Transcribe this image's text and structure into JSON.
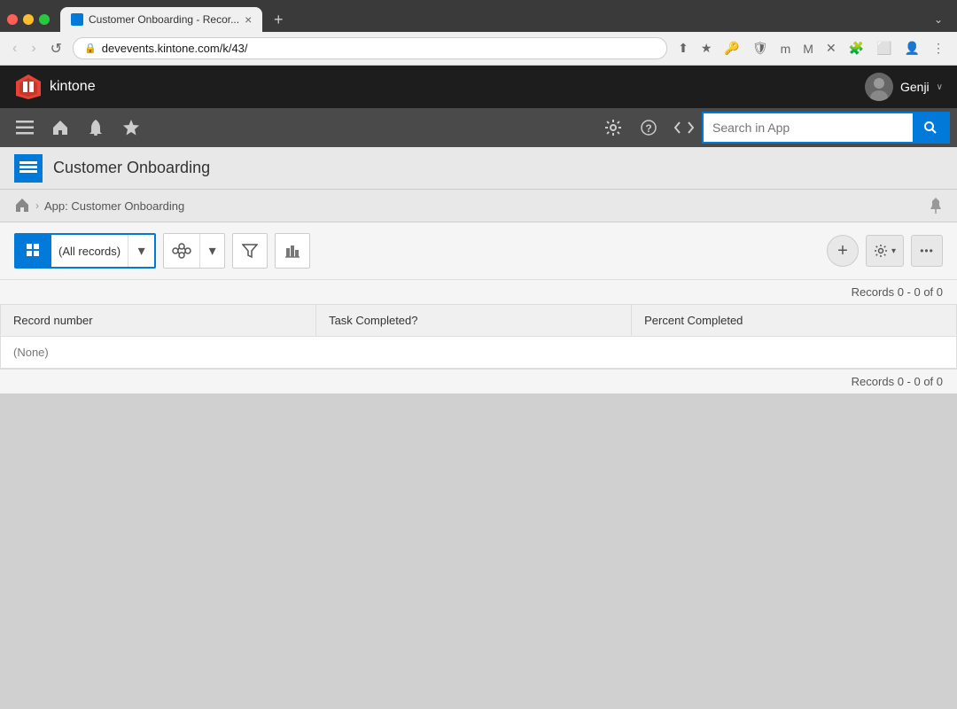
{
  "browser": {
    "tab_title": "Customer Onboarding - Recor...",
    "tab_close": "×",
    "tab_new": "+",
    "address": "devevents.kintone.com/k/43/",
    "nav_back": "‹",
    "nav_forward": "›",
    "nav_refresh": "↺",
    "extension_chevron": "»"
  },
  "header": {
    "logo_text": "kintone",
    "user_name": "Genji",
    "user_chevron": "∨"
  },
  "nav": {
    "menu_icon": "≡",
    "home_icon": "⌂",
    "bell_icon": "🔔",
    "star_icon": "★",
    "gear_icon": "⚙",
    "help_icon": "?",
    "dev_icon": "</>",
    "search_placeholder": "Search in App",
    "search_icon": "🔍"
  },
  "app_header": {
    "title": "Customer Onboarding"
  },
  "breadcrumb": {
    "home_icon": "⌂",
    "separator": "›",
    "text": "App: Customer Onboarding",
    "pin_icon": "📌"
  },
  "toolbar": {
    "view_label": "(All records)",
    "view_dropdown_icon": "▾",
    "add_label": "+",
    "settings_icon": "⚙",
    "settings_dropdown": "▾",
    "more_icon": "•••"
  },
  "records": {
    "count_top": "Records 0 - 0 of 0",
    "count_bottom": "Records 0 - 0 of 0"
  },
  "table": {
    "columns": [
      "Record number",
      "Task Completed?",
      "Percent Completed"
    ],
    "empty_label": "(None)"
  }
}
